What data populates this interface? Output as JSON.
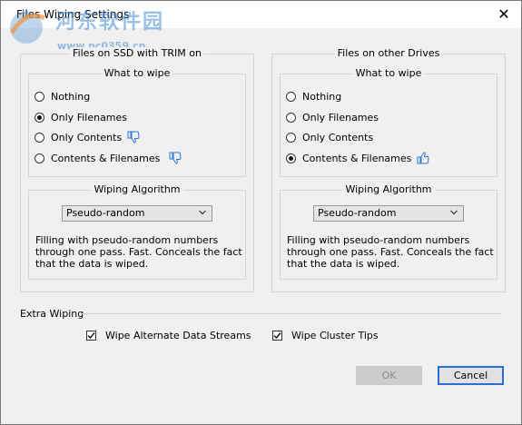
{
  "window": {
    "title": "Files Wiping Settings",
    "close_glyph": "✕"
  },
  "watermark": {
    "line1": "河东软件园",
    "line2": "www.pc0359.cn"
  },
  "ssd": {
    "title": "Files on SSD with TRIM on",
    "what_to_wipe": "What to wipe",
    "options": [
      "Nothing",
      "Only Filenames",
      "Only Contents",
      "Contents & Filenames"
    ],
    "selected": "Only Filenames",
    "algorithm_title": "Wiping Algorithm",
    "algorithm": "Pseudo-random",
    "description": "Filling with pseudo-random numbers through one pass. Fast. Conceals the fact that the data is wiped."
  },
  "other": {
    "title": "Files on other Drives",
    "what_to_wipe": "What to wipe",
    "options": [
      "Nothing",
      "Only Filenames",
      "Only Contents",
      "Contents & Filenames"
    ],
    "selected": "Contents & Filenames",
    "algorithm_title": "Wiping Algorithm",
    "algorithm": "Pseudo-random",
    "description": "Filling with pseudo-random numbers through one pass. Fast. Conceals the fact that the data is wiped."
  },
  "extra": {
    "title": "Extra Wiping",
    "alt_streams": {
      "label": "Wipe Alternate Data Streams",
      "checked": true
    },
    "cluster_tips": {
      "label": "Wipe Cluster Tips",
      "checked": true
    }
  },
  "buttons": {
    "ok": "OK",
    "cancel": "Cancel"
  },
  "colors": {
    "accent": "#2a6fd6",
    "thumb": "#2b78d8"
  }
}
